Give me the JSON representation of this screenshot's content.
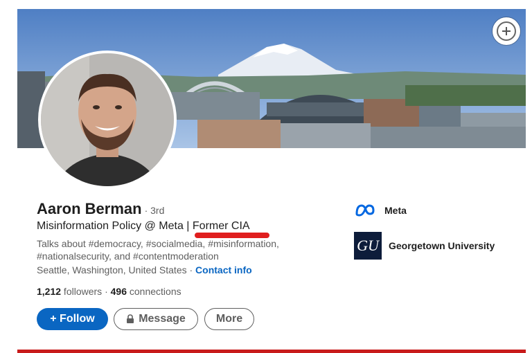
{
  "profile": {
    "name": "Aaron Berman",
    "degree": "· 3rd",
    "headline": "Misinformation Policy @ Meta | Former CIA",
    "about": "Talks about #democracy, #socialmedia, #misinformation, #nationalsecurity, and #contentmoderation",
    "location": "Seattle, Washington, United States · ",
    "contact_info": "Contact info",
    "followers_count": "1,212",
    "followers_label": " followers",
    "separator": " · ",
    "connections_count": "496",
    "connections_label": " connections"
  },
  "actions": {
    "follow": "+ Follow",
    "message": "Message",
    "more": "More"
  },
  "organizations": [
    {
      "name": "Meta",
      "icon": "meta-logo"
    },
    {
      "name": "Georgetown University",
      "icon": "georgetown-logo",
      "logo_text": "GU"
    }
  ],
  "colors": {
    "accent": "#0a66c2",
    "highlight_underline": "#e01e1e",
    "bottom_bar": "#c81b1b"
  },
  "banner": {
    "icon": "add-photo-icon"
  }
}
